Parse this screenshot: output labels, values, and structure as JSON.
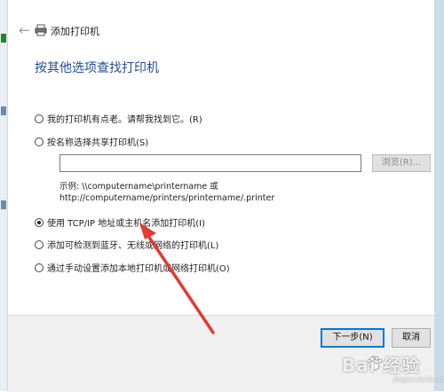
{
  "window": {
    "title": "添加打印机",
    "back_icon": "back-arrow-icon",
    "printer_icon": "printer-icon"
  },
  "heading": "按其他选项查找打印机",
  "options": [
    {
      "label": "我的打印机有点老。请帮我找到它。(R)",
      "checked": false
    },
    {
      "label": "按名称选择共享打印机(S)",
      "checked": false
    },
    {
      "label": "使用 TCP/IP 地址或主机名添加打印机(I)",
      "checked": true
    },
    {
      "label": "添加可检测到蓝牙、无线或网络的打印机(L)",
      "checked": false
    },
    {
      "label": "通过手动设置添加本地打印机或网络打印机(O)",
      "checked": false
    }
  ],
  "shared_printer": {
    "input_value": "",
    "browse_label": "浏览(R)...",
    "example_line1": "示例: \\\\computername\\printername 或",
    "example_line2": "http://computername/printers/printername/.printer"
  },
  "footer": {
    "next_label": "下一步(N)",
    "cancel_label": "取消"
  },
  "watermark": {
    "text": "Bai 经验",
    "sub": "jingyan.baidu.com"
  },
  "colors": {
    "heading": "#1f4e99",
    "annotation_arrow": "#e53935",
    "accent": "#0078d7"
  }
}
